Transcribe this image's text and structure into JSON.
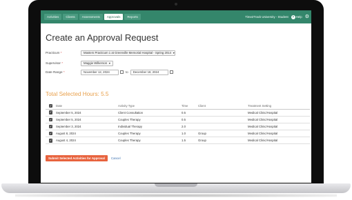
{
  "nav": {
    "tabs": [
      {
        "label": "Activities"
      },
      {
        "label": "Clients"
      },
      {
        "label": "Assessments"
      },
      {
        "label": "Approvals"
      },
      {
        "label": "Reports"
      }
    ],
    "active_tab": "Approvals",
    "user": "Time2Track University - Student",
    "help_label": "Help",
    "colors": {
      "nav_bg": "#34866b",
      "accent_orange": "#e8a04c",
      "submit_bg": "#e8633e"
    }
  },
  "page": {
    "title": "Create an Approval Request"
  },
  "form": {
    "practicum_label": "Practicum",
    "practicum_value": "Masters Practicum 1 at Greenville Memorial Hospital - Spring 2014",
    "supervisor_label": "Supervisor",
    "supervisor_value": "Maggie Wilkerson",
    "date_range_label": "Date Range",
    "date_from": "November 12, 2024",
    "to_label": "to",
    "date_to": "December 18, 2024",
    "required_marker": "*"
  },
  "summary": {
    "total_label": "Total Selected Hours: 5.5"
  },
  "table": {
    "headers": {
      "date": "Date",
      "activity_type": "Activity Type",
      "time": "Time",
      "client": "Client",
      "setting": "Treatment Setting"
    },
    "rows": [
      {
        "date": "September 5, 2024",
        "activity_type": "Client Consultation",
        "time": "0.5",
        "client": "",
        "setting": "Medical Clinic/Hospital"
      },
      {
        "date": "September 5, 2024",
        "activity_type": "Couples Therapy",
        "time": "0.5",
        "client": "",
        "setting": "Medical Clinic/Hospital"
      },
      {
        "date": "September 3, 2024",
        "activity_type": "Individual Therapy",
        "time": "2.0",
        "client": "",
        "setting": "Medical Clinic/Hospital"
      },
      {
        "date": "August 8, 2024",
        "activity_type": "Couples Therapy",
        "time": "1.0",
        "client": "Group",
        "setting": "Medical Clinic/Hospital"
      },
      {
        "date": "August 4, 2024",
        "activity_type": "Couples Therapy",
        "time": "1.5",
        "client": "Group",
        "setting": "Medical Clinic/Hospital"
      }
    ]
  },
  "actions": {
    "submit_label": "Submit Selected Activities for Approval",
    "cancel_label": "Cancel"
  },
  "icons": {
    "help": "help-icon",
    "settings": "gear-icon",
    "calendar": "calendar-icon",
    "checkbox": "checkbox-checked-icon",
    "dropdown": "chevron-down-icon"
  }
}
